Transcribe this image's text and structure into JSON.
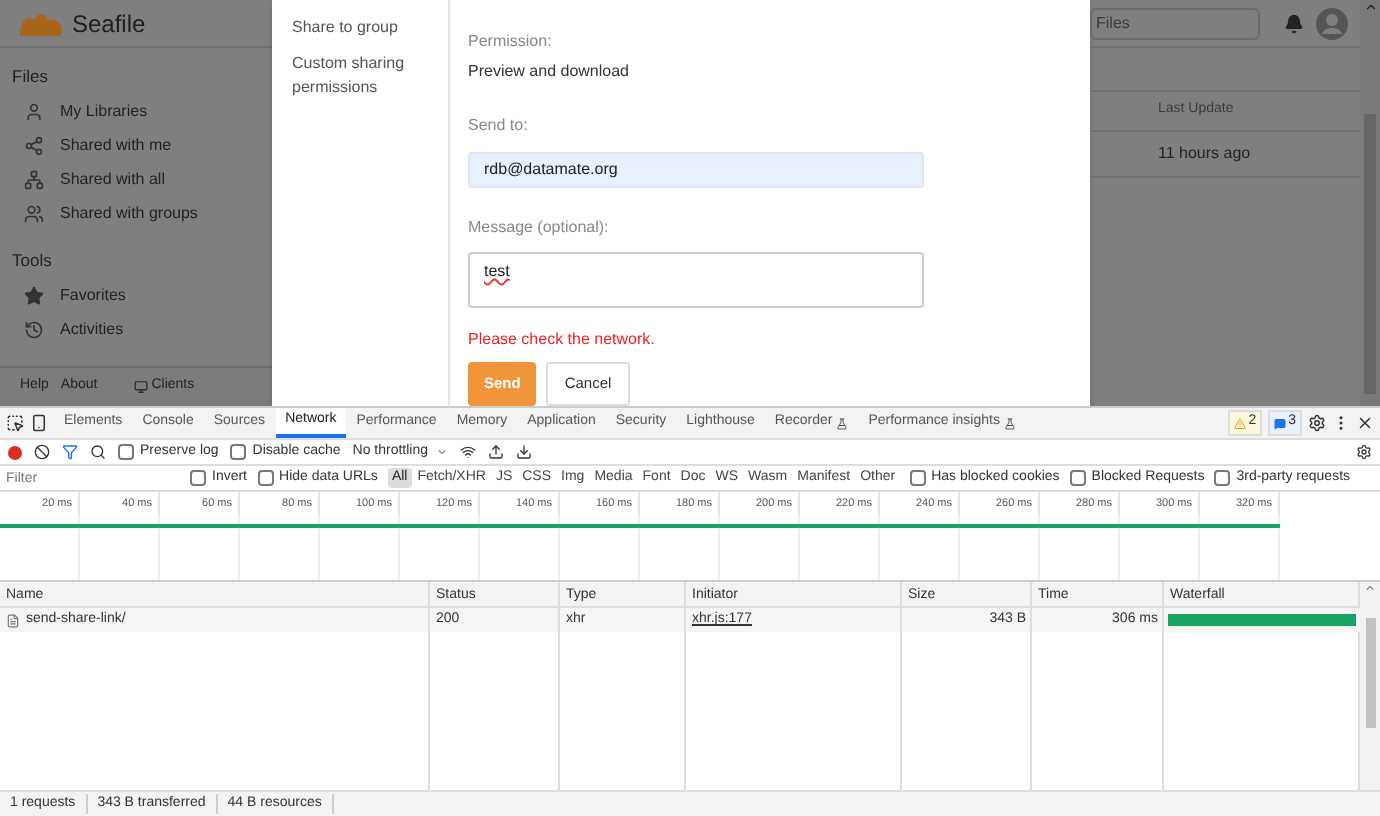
{
  "app": {
    "logo_text": "Seafile",
    "search_placeholder": "Files",
    "sidebar": [
      {
        "title": "Files",
        "items": [
          "My Libraries",
          "Shared with me",
          "Shared with all",
          "Shared with groups"
        ]
      },
      {
        "title": "Tools",
        "items": [
          "Favorites",
          "Activities"
        ]
      }
    ],
    "footer": [
      "Help",
      "About"
    ],
    "clients": "Clients",
    "column": "Last Update",
    "row_time": "11 hours ago"
  },
  "dialog": {
    "nav": [
      "Share to group",
      "Custom sharing permissions"
    ],
    "permission_label": "Permission:",
    "permission_value": "Preview and download",
    "send_to_label": "Send to:",
    "send_to_value": "rdb@datamate.org",
    "message_label": "Message (optional):",
    "message_value": "test",
    "error": "Please check the network.",
    "buttons": [
      "Send",
      "Cancel"
    ]
  },
  "devtools": {
    "tabs": [
      {
        "label": "Elements",
        "selected": false
      },
      {
        "label": "Console",
        "selected": false
      },
      {
        "label": "Sources",
        "selected": false
      },
      {
        "label": "Network",
        "selected": true
      },
      {
        "label": "Performance",
        "selected": false
      },
      {
        "label": "Memory",
        "selected": false
      },
      {
        "label": "Application",
        "selected": false
      },
      {
        "label": "Security",
        "selected": false
      },
      {
        "label": "Lighthouse",
        "selected": false
      },
      {
        "label": "Recorder",
        "selected": false,
        "experimental": true
      },
      {
        "label": "Performance insights",
        "selected": false,
        "experimental": true
      }
    ],
    "warnings": "2",
    "messages": "3",
    "toolbar": [
      {
        "label": "Preserve log",
        "checked": false
      },
      {
        "label": "Disable cache",
        "checked": false
      }
    ],
    "throttling": "No throttling",
    "filter_placeholder": "Filter",
    "filter_checks": [
      {
        "label": "Invert",
        "checked": false
      },
      {
        "label": "Hide data URLs",
        "checked": false
      }
    ],
    "types": [
      {
        "label": "All",
        "selected": true
      },
      {
        "label": "Fetch/XHR",
        "selected": false
      },
      {
        "label": "JS",
        "selected": false
      },
      {
        "label": "CSS",
        "selected": false
      },
      {
        "label": "Img",
        "selected": false
      },
      {
        "label": "Media",
        "selected": false
      },
      {
        "label": "Font",
        "selected": false
      },
      {
        "label": "Doc",
        "selected": false
      },
      {
        "label": "WS",
        "selected": false
      },
      {
        "label": "Wasm",
        "selected": false
      },
      {
        "label": "Manifest",
        "selected": false
      },
      {
        "label": "Other",
        "selected": false
      }
    ],
    "extra_checks": [
      {
        "label": "Has blocked cookies",
        "checked": false
      },
      {
        "label": "Blocked Requests",
        "checked": false
      },
      {
        "label": "3rd-party requests",
        "checked": false
      }
    ],
    "ticks": [
      "20 ms",
      "40 ms",
      "60 ms",
      "80 ms",
      "100 ms",
      "120 ms",
      "140 ms",
      "160 ms",
      "180 ms",
      "200 ms",
      "220 ms",
      "240 ms",
      "260 ms",
      "280 ms",
      "300 ms",
      "320 ms"
    ],
    "columns": [
      "Name",
      "Status",
      "Type",
      "Initiator",
      "Size",
      "Time",
      "Waterfall"
    ],
    "rows": [
      {
        "name": "send-share-link/",
        "status": "200",
        "type": "xhr",
        "initiator": "xhr.js:177",
        "size": "343 B",
        "time": "306 ms"
      }
    ],
    "status_bar": [
      "1 requests",
      "343 B transferred",
      "44 B resources"
    ]
  }
}
